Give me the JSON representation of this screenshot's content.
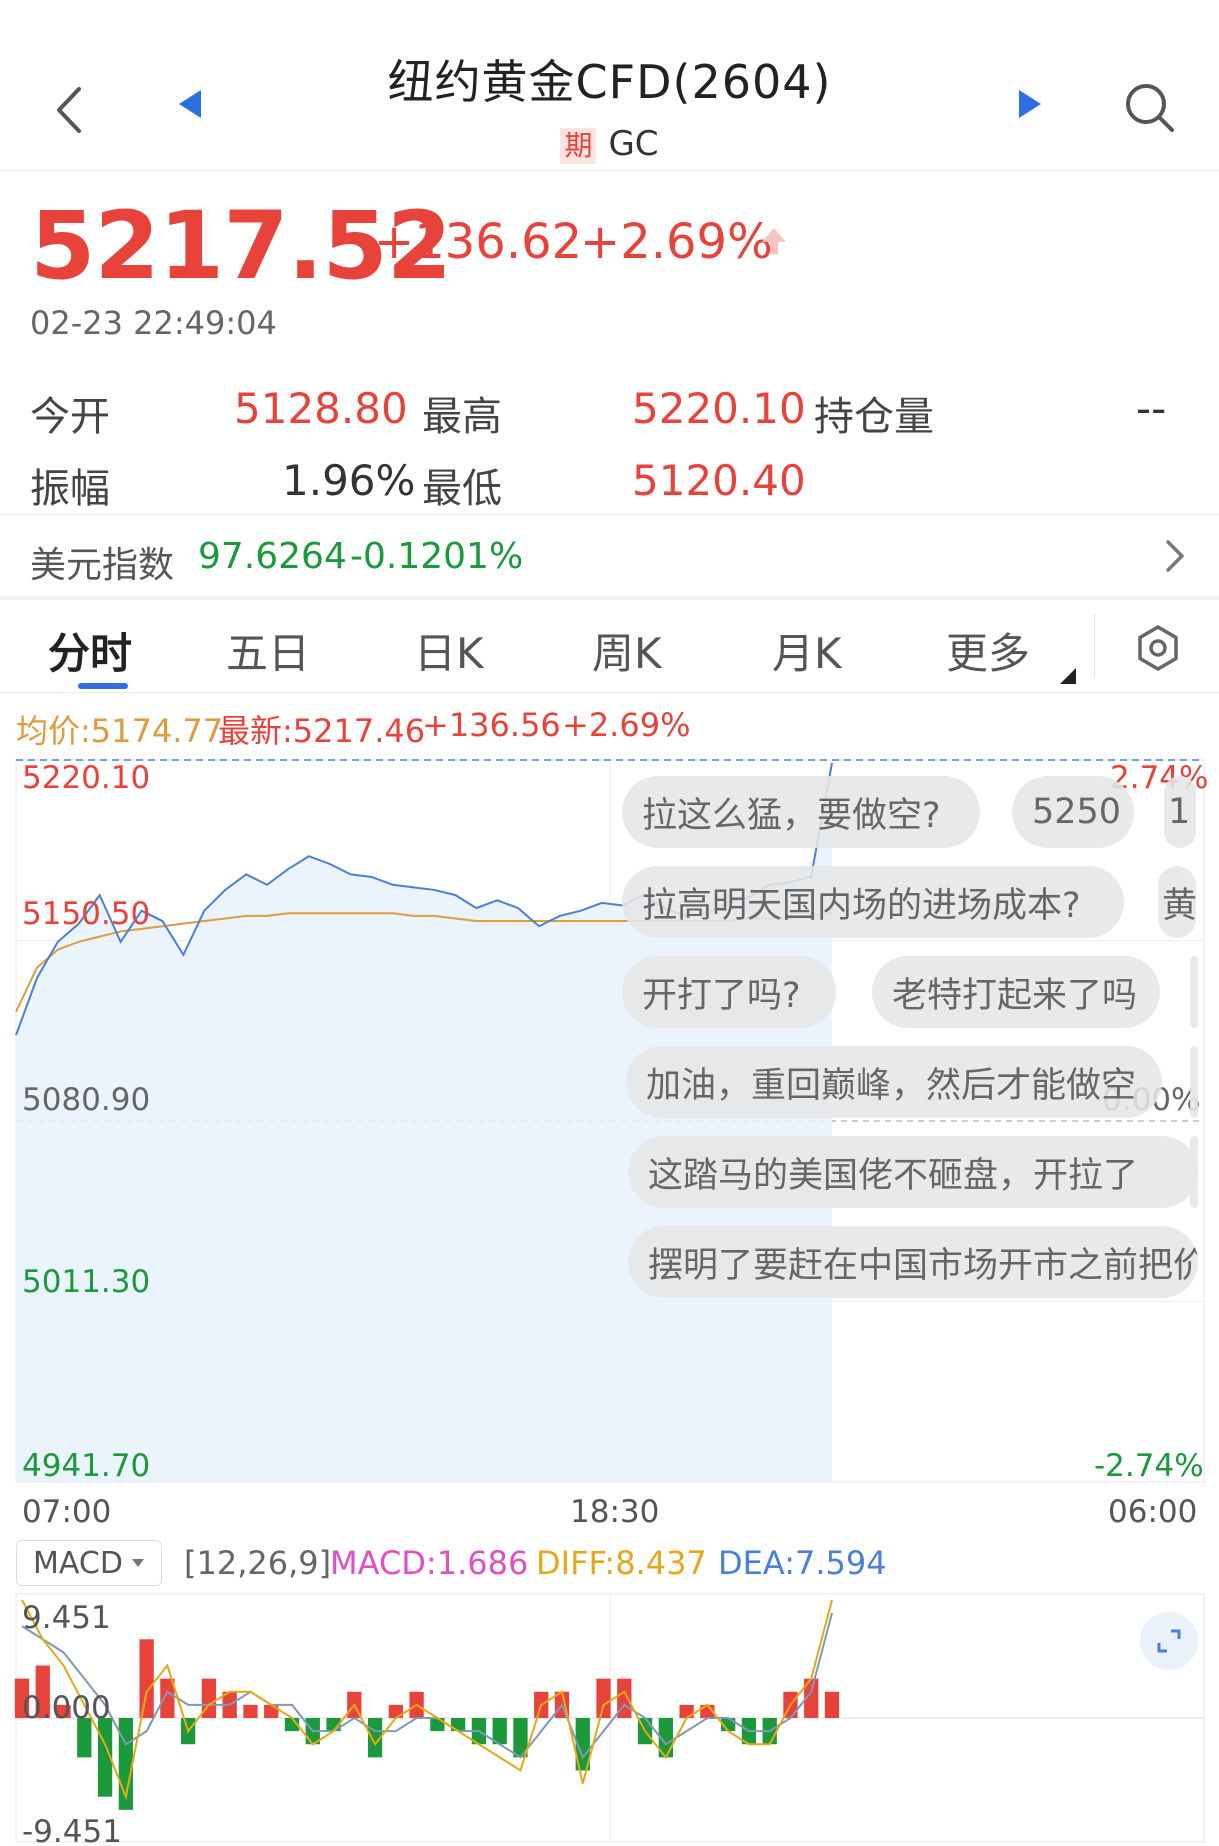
{
  "header": {
    "title": "纽约黄金CFD(2604)",
    "badge": "期",
    "code": "GC"
  },
  "quote": {
    "price": "5217.52",
    "change": "+136.62",
    "change_pct": "+2.69%",
    "timestamp": "02-23 22:49:04"
  },
  "stats": {
    "open_label": "今开",
    "open_value": "5128.80",
    "high_label": "最高",
    "high_value": "5220.10",
    "oi_label": "持仓量",
    "oi_value": "--",
    "amp_label": "振幅",
    "amp_value": "1.96%",
    "low_label": "最低",
    "low_value": "5120.40"
  },
  "dollar_index": {
    "label": "美元指数",
    "value": "97.6264",
    "change": "-0.1201%"
  },
  "tabs": [
    "分时",
    "五日",
    "日K",
    "周K",
    "月K",
    "更多"
  ],
  "chart_legend": {
    "avg": "均价:5174.77",
    "latest": "最新:5217.46",
    "change": "+136.56",
    "pct": "+2.69%"
  },
  "chart_data": {
    "type": "line",
    "x_labels": [
      "07:00",
      "18:30",
      "06:00"
    ],
    "y_labels": [
      "5220.10",
      "5150.50",
      "5080.90",
      "5011.30",
      "4941.70"
    ],
    "pct_labels": [
      "2.74%",
      "0.00%",
      "-2.74%"
    ],
    "ylim": [
      4941.7,
      5220.1
    ],
    "series": [
      {
        "values": [
          5114,
          5136,
          5150,
          5157,
          5168,
          5150,
          5162,
          5158,
          5145,
          5162,
          5170,
          5176,
          5172,
          5178,
          5183,
          5180,
          5176,
          5175,
          5172,
          5171,
          5170,
          5168,
          5163,
          5166,
          5163,
          5156,
          5160,
          5162,
          5165,
          5164,
          5168,
          5163,
          5160,
          5161,
          5165,
          5167,
          5172,
          5173,
          5175,
          5219
        ]
      },
      {
        "values": [
          5123,
          5140,
          5147,
          5150,
          5152,
          5154,
          5155,
          5156,
          5157,
          5158,
          5159,
          5160,
          5160,
          5161,
          5161,
          5161,
          5161,
          5161,
          5161,
          5160,
          5160,
          5159,
          5158,
          5158,
          5158,
          5158,
          5158,
          5158,
          5158,
          5158,
          5158,
          5158,
          5158,
          5158,
          5158,
          5159,
          5159,
          5159,
          5160,
          5161
        ]
      }
    ]
  },
  "comments": [
    "拉这么猛，要做空?",
    "5250",
    "1",
    "拉高明天国内场的进场成本?",
    "黄",
    "开打了吗?",
    "老特打起来了吗",
    "",
    "加油，重回巅峰，然后才能做空",
    "",
    "这踏马的美国佬不砸盘，开拉了",
    "",
    "摆明了要赶在中国市场开市之前把价"
  ],
  "macd": {
    "selector": "MACD",
    "params": "[12,26,9]",
    "macd": "MACD:1.686",
    "diff": "DIFF:8.437",
    "dea": "DEA:7.594",
    "y_labels": [
      "9.451",
      "0.000",
      "-9.451"
    ],
    "ylim": [
      -9.451,
      9.451
    ],
    "hist": [
      3,
      4,
      1,
      -3,
      -6,
      -7,
      6,
      3,
      -2,
      3,
      2,
      1,
      1,
      -1,
      -2,
      -1,
      2,
      -3,
      1,
      2,
      -1,
      -1,
      -2,
      -2,
      -3,
      2,
      2,
      -4,
      3,
      3,
      -2,
      -3,
      1,
      1,
      -1,
      -2,
      -2,
      2,
      3,
      2
    ],
    "diff_values": [
      9,
      6,
      4,
      1,
      -2,
      -6,
      2,
      4,
      -1,
      1,
      2,
      2,
      1,
      0,
      -2,
      -1,
      1,
      -2,
      0,
      1,
      0,
      -1,
      -2,
      -3,
      -4,
      1,
      2,
      -5,
      1,
      2,
      -1,
      -3,
      0,
      1,
      -1,
      -2,
      -2,
      1,
      3,
      9
    ],
    "dea_values": [
      7,
      6,
      5,
      3,
      1,
      -2,
      -1,
      2,
      1,
      1,
      1,
      2,
      1,
      1,
      -1,
      -1,
      0,
      -1,
      -1,
      0,
      0,
      -1,
      -1,
      -2,
      -3,
      -1,
      1,
      -3,
      -1,
      1,
      0,
      -2,
      -1,
      0,
      0,
      -1,
      -1,
      0,
      2,
      8
    ]
  },
  "colors": {
    "up": "#e8433b",
    "down": "#1a9a3a",
    "price_line": "#4a80d6",
    "avg_line": "#e09b3d",
    "macd": "#e04fc4",
    "diff": "#e6a817",
    "dea": "#4a80d6"
  }
}
